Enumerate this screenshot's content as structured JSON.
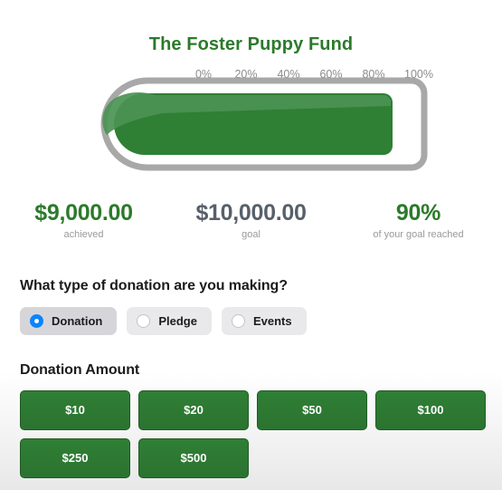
{
  "header": {
    "title": "The Foster Puppy Fund",
    "title_color": "#2b7a2b"
  },
  "thermometer": {
    "percent": 90,
    "scale_labels": [
      "0%",
      "20%",
      "40%",
      "60%",
      "80%",
      "100%"
    ],
    "tick_count": 11,
    "fill_color": "#2f7f35",
    "highlight_color": "#4b9352",
    "outline_color": "#a8a8a8"
  },
  "stats": [
    {
      "value": "$9,000.00",
      "label": "achieved",
      "color": "#2b7a2b"
    },
    {
      "value": "$10,000.00",
      "label": "goal",
      "color": "#57606a"
    },
    {
      "value": "90%",
      "label": "of your goal reached",
      "color": "#2b7a2b"
    }
  ],
  "donation_type": {
    "heading": "What type of donation are you making?",
    "options": [
      {
        "label": "Donation",
        "selected": true
      },
      {
        "label": "Pledge",
        "selected": false
      },
      {
        "label": "Events",
        "selected": false
      }
    ],
    "selected_color": "#0a84ff"
  },
  "donation_amount": {
    "heading": "Donation Amount",
    "buttons": [
      "$10",
      "$20",
      "$50",
      "$100",
      "$250",
      "$500"
    ],
    "button_color": "#2f7f35"
  }
}
